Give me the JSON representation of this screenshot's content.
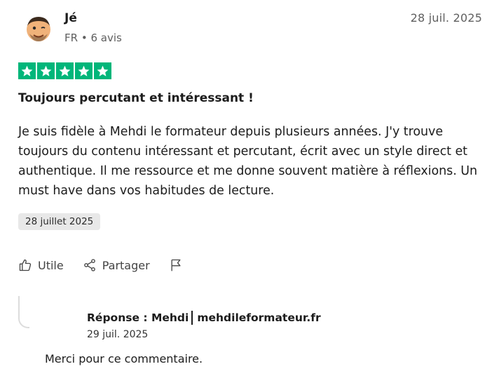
{
  "review": {
    "author": "Jé",
    "country": "FR",
    "separator": "•",
    "reviews_count": "6 avis",
    "date": "28 juil. 2025",
    "rating": 5,
    "title": "Toujours percutant et intéressant !",
    "text": "Je suis fidèle à Mehdi le formateur depuis plusieurs années. J'y trouve toujours du contenu intéressant et percutant, écrit avec un style direct et authentique. Il me ressource et me donne souvent matière à réflexions. Un must have dans vos habitudes de lecture.",
    "experience_date": "28 juillet 2025"
  },
  "actions": {
    "useful_label": "Utile",
    "share_label": "Partager"
  },
  "reply": {
    "prefix": "Réponse : Mehdi",
    "company": "mehdileformateur.fr",
    "date": "29 juil. 2025",
    "text": "Merci pour ce commentaire."
  },
  "colors": {
    "star_green": "#00b67a",
    "pill_bg": "#e8e8e8"
  },
  "icons": [
    "avatar-emoji",
    "star-icon",
    "thumbs-up-icon",
    "share-icon",
    "flag-icon"
  ]
}
